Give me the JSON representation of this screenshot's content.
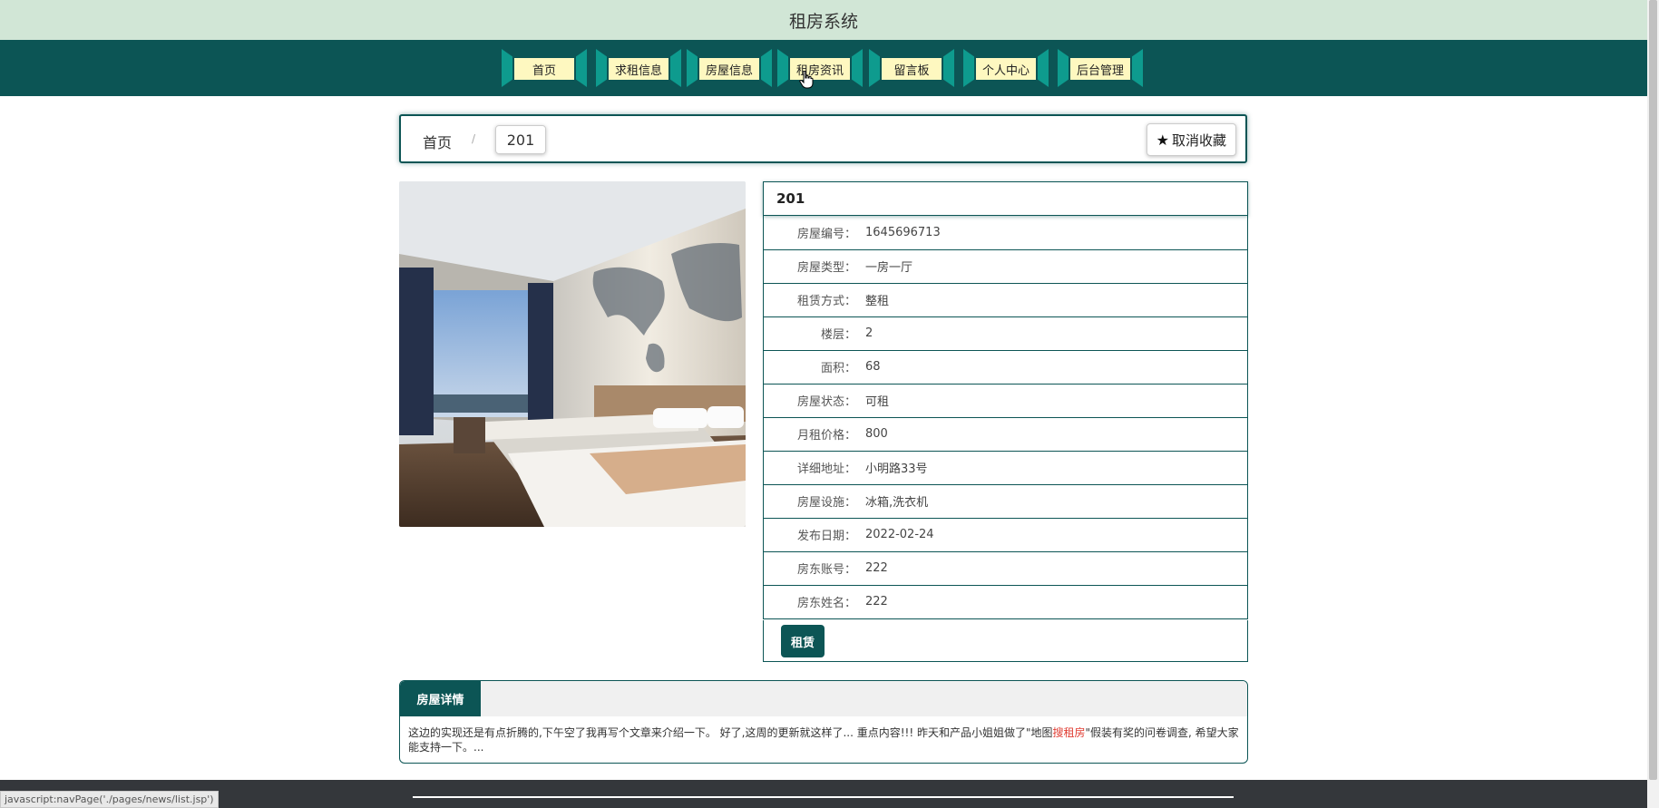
{
  "site": {
    "title": "租房系统"
  },
  "nav": {
    "items": [
      {
        "label": "首页"
      },
      {
        "label": "求租信息"
      },
      {
        "label": "房屋信息"
      },
      {
        "label": "租房资讯"
      },
      {
        "label": "留言板"
      },
      {
        "label": "个人中心"
      },
      {
        "label": "后台管理"
      }
    ]
  },
  "breadcrumb": {
    "home": "首页",
    "separator": "/",
    "current": "201"
  },
  "favorite": {
    "label": "取消收藏",
    "icon": "star-icon"
  },
  "house": {
    "title": "201",
    "fields": [
      {
        "key": "房屋编号：",
        "value": "1645696713"
      },
      {
        "key": "房屋类型：",
        "value": "一房一厅"
      },
      {
        "key": "租赁方式：",
        "value": "整租"
      },
      {
        "key": "楼层：",
        "value": "2"
      },
      {
        "key": "面积：",
        "value": "68"
      },
      {
        "key": "房屋状态：",
        "value": "可租"
      },
      {
        "key": "月租价格：",
        "value": "800"
      },
      {
        "key": "详细地址：",
        "value": "小明路33号"
      },
      {
        "key": "房屋设施：",
        "value": "冰箱,洗衣机"
      },
      {
        "key": "发布日期：",
        "value": "2022-02-24"
      },
      {
        "key": "房东账号：",
        "value": "222"
      },
      {
        "key": "房东姓名：",
        "value": "222"
      }
    ],
    "action_label": "租赁"
  },
  "detail": {
    "tab_label": "房屋详情",
    "text_before": "这边的实现还是有点折腾的,下午空了我再写个文章来介绍一下。 好了,这周的更新就这样了... 重点内容!!! 昨天和产品小姐姐做了\"地图",
    "text_highlight": "搜租房",
    "text_after": "\"假装有奖的问卷调查, 希望大家能支持一下。..."
  },
  "status_bar": {
    "url": "javascript:navPage('./pages/news/list.jsp')"
  },
  "colors": {
    "primary": "#0c5555",
    "header_bg": "#d1e6d6",
    "nav_label_bg": "#fef8c0",
    "nav_wing": "#0e9b8e",
    "highlight": "#e03c32",
    "footer": "#34373b"
  }
}
